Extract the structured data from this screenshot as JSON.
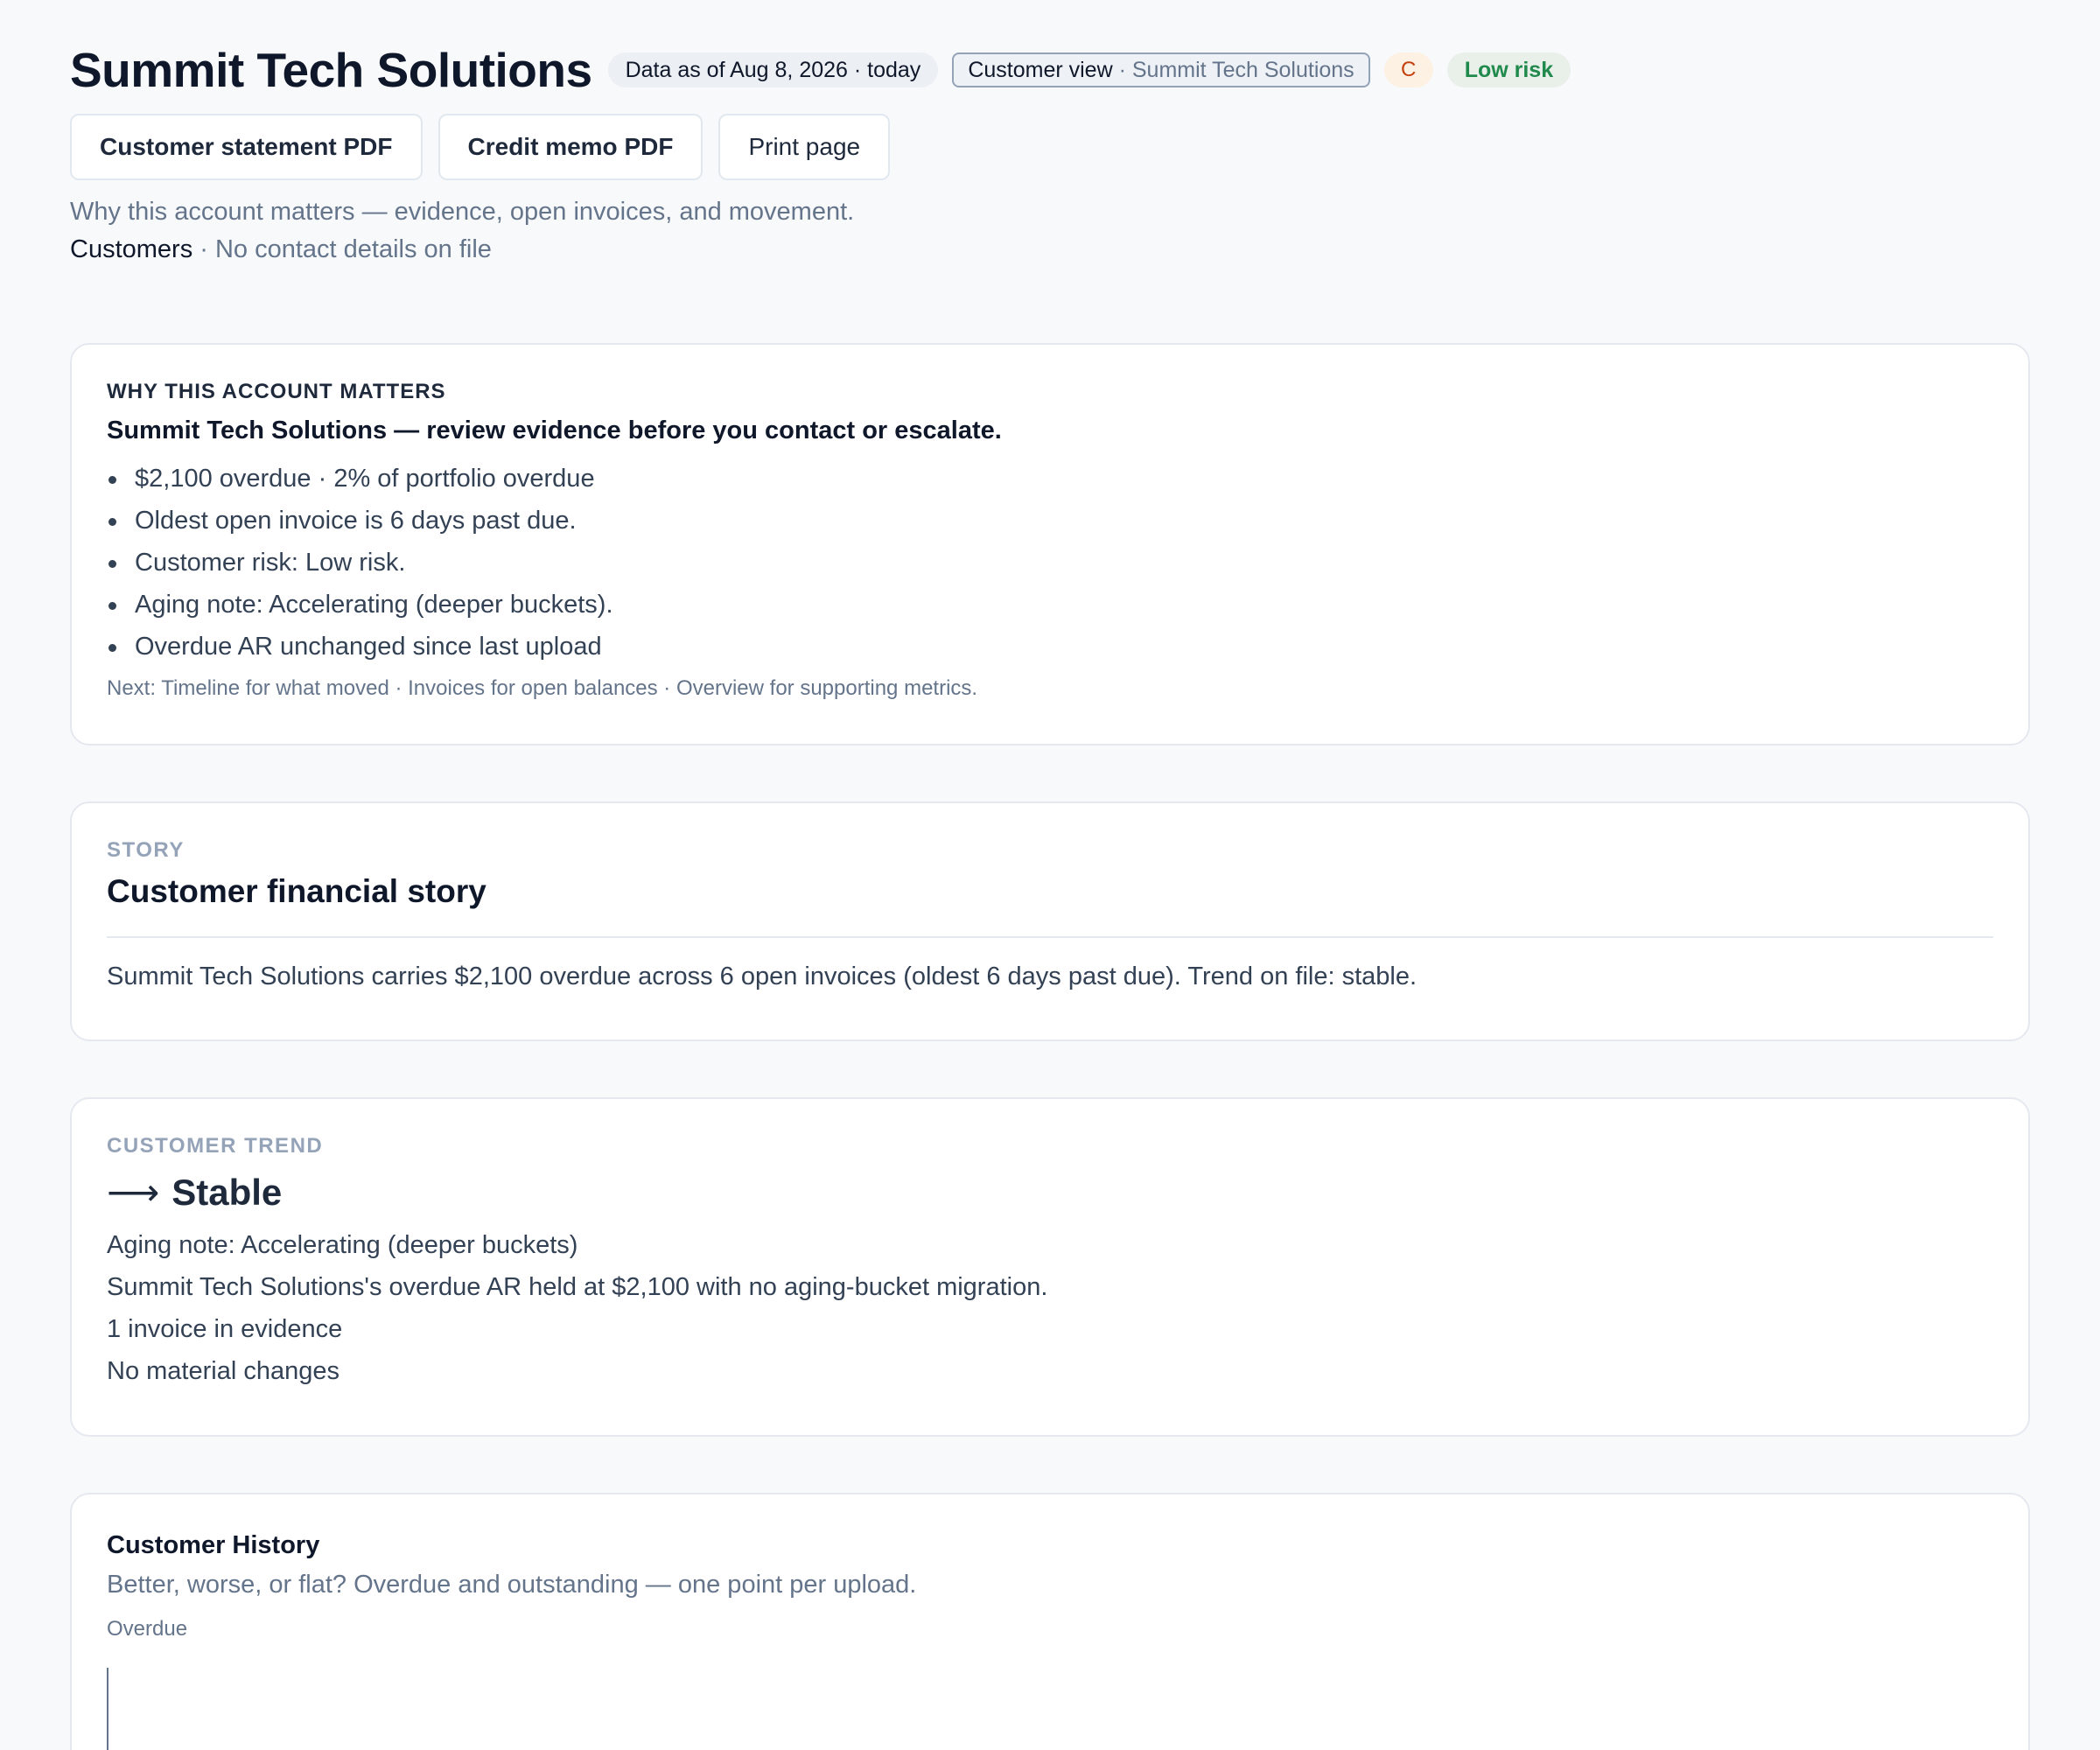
{
  "header": {
    "title": "Summit Tech Solutions",
    "data_as_of": "Data as of Aug 8, 2026 · today",
    "view_label": "Customer view",
    "view_sub": "· Summit Tech Solutions",
    "grade": "C",
    "risk": "Low risk"
  },
  "actions": {
    "statement_pdf": "Customer statement PDF",
    "credit_memo_pdf": "Credit memo PDF",
    "print_page": "Print page"
  },
  "tagline": "Why this account matters — evidence, open invoices, and movement.",
  "breadcrumb": {
    "link": "Customers",
    "rest": " · No contact details on file"
  },
  "why": {
    "eyebrow": "Why this account matters",
    "heading": "Summit Tech Solutions — review evidence before you contact or escalate.",
    "items": [
      "$2,100 overdue · 2% of portfolio overdue",
      "Oldest open invoice is 6 days past due.",
      "Customer risk: Low risk.",
      "Aging note: Accelerating (deeper buckets).",
      "Overdue AR unchanged since last upload"
    ],
    "next": "Next: Timeline for what moved · Invoices for open balances · Overview for supporting metrics."
  },
  "story": {
    "eyebrow": "Story",
    "title": "Customer financial story",
    "body": "Summit Tech Solutions carries $2,100 overdue across 6 open invoices (oldest 6 days past due). Trend on file: stable."
  },
  "trend": {
    "eyebrow": "Customer trend",
    "arrow": "⟶",
    "title": "Stable",
    "lines": [
      "Aging note: Accelerating (deeper buckets)",
      "Summit Tech Solutions's overdue AR held at $2,100 with no aging-bucket migration.",
      "1 invoice in evidence",
      "No material changes"
    ]
  },
  "history": {
    "title": "Customer History",
    "subtitle": "Better, worse, or flat? Overdue and outstanding — one point per upload.",
    "axis_label": "Overdue"
  },
  "colors": {
    "accent_green": "#1f8a4c",
    "grade_orange": "#c2410c",
    "muted": "#64748b"
  }
}
